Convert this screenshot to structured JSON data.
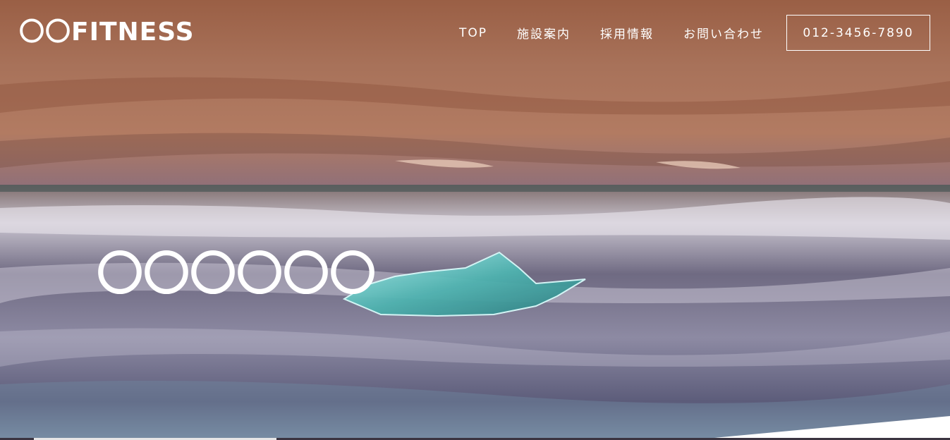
{
  "header": {
    "logo_text": "〇〇FITNESS",
    "nav": [
      {
        "label": "TOP"
      },
      {
        "label": "施設案内"
      },
      {
        "label": "採用情報"
      },
      {
        "label": "お問い合わせ"
      }
    ],
    "phone": "012-3456-7890"
  },
  "hero": {
    "heading": "〇〇〇〇〇〇"
  }
}
